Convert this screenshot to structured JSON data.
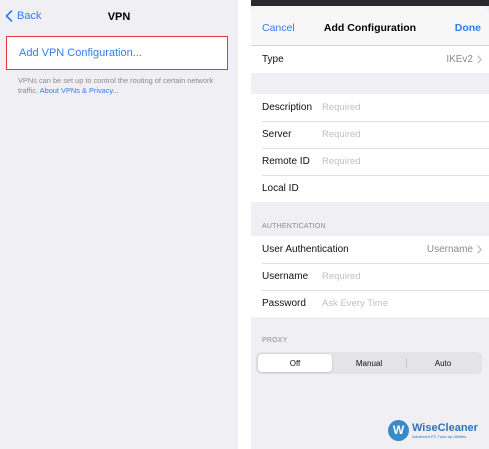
{
  "left": {
    "back_label": "Back",
    "title": "VPN",
    "add_vpn_label": "Add VPN Configuration...",
    "info_text": "VPNs can be set up to control the routing of certain network traffic.",
    "info_link": "About VPNs & Privacy..."
  },
  "right": {
    "cancel_label": "Cancel",
    "title": "Add Configuration",
    "done_label": "Done",
    "type_row": {
      "label": "Type",
      "value": "IKEv2"
    },
    "config_rows": [
      {
        "label": "Description",
        "placeholder": "Required"
      },
      {
        "label": "Server",
        "placeholder": "Required"
      },
      {
        "label": "Remote ID",
        "placeholder": "Required"
      },
      {
        "label": "Local ID",
        "placeholder": ""
      }
    ],
    "auth_section_label": "AUTHENTICATION",
    "auth_rows": {
      "user_auth": {
        "label": "User Authentication",
        "value": "Username"
      },
      "username": {
        "label": "Username",
        "placeholder": "Required"
      },
      "password": {
        "label": "Password",
        "placeholder": "Ask Every Time"
      }
    },
    "proxy_section_label": "PROXY",
    "proxy_options": [
      "Off",
      "Manual",
      "Auto"
    ],
    "proxy_selected": "Off"
  },
  "watermark": {
    "badge": "W",
    "name": "WiseCleaner",
    "tagline": "Advanced PC Tune-up Utilities"
  },
  "colors": {
    "accent": "#2f7cf6",
    "highlight_border": "#e5333f",
    "grouped_background": "#efeff4",
    "placeholder": "#c0c0c5"
  }
}
